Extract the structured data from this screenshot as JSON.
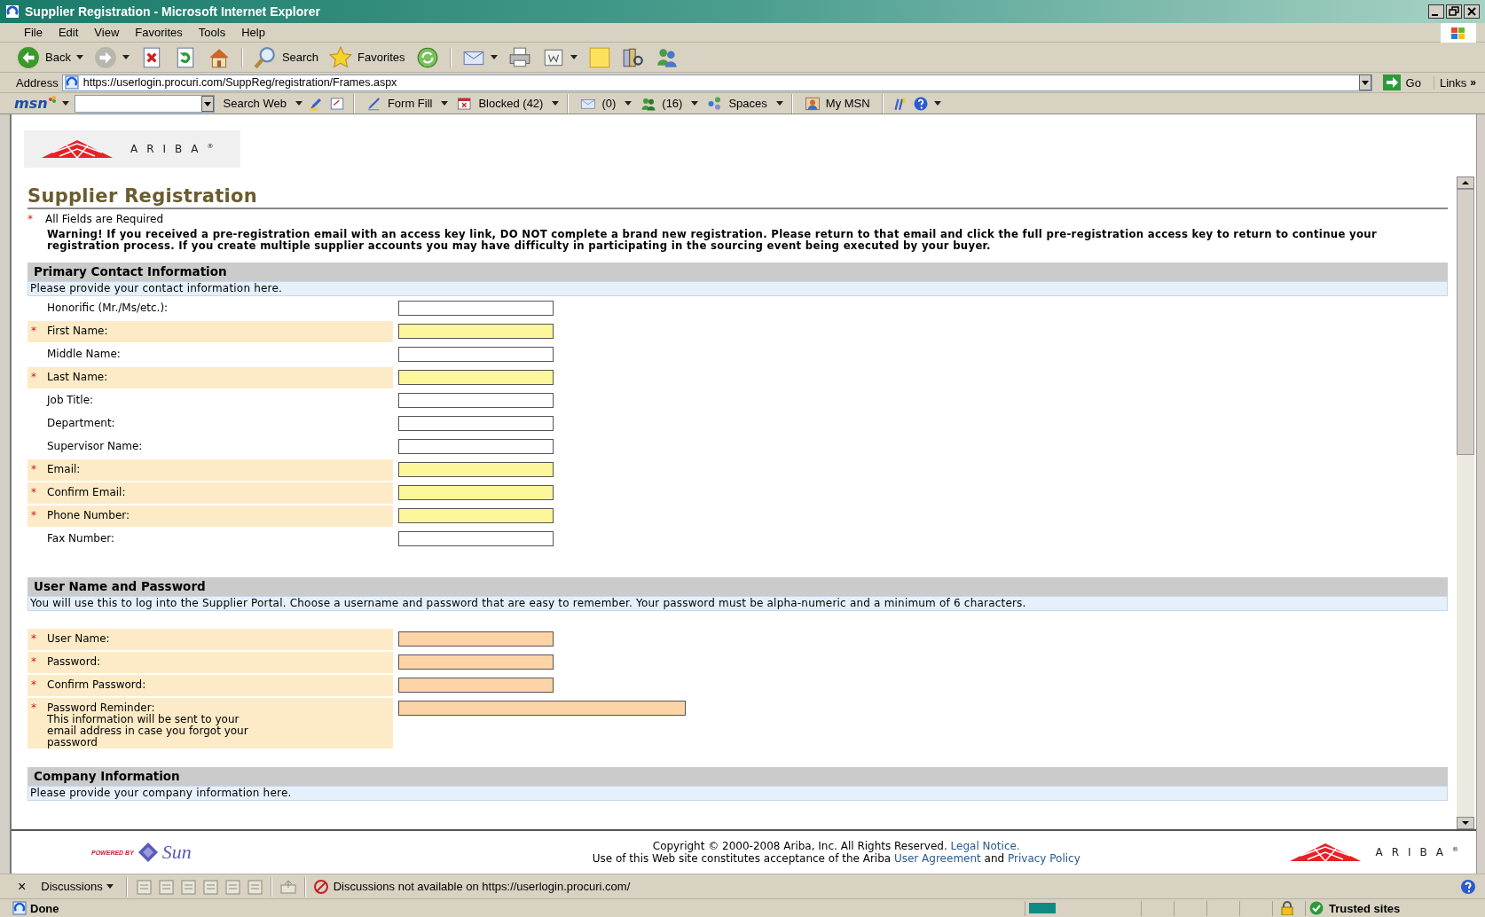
{
  "window": {
    "title": "Supplier Registration - Microsoft Internet Explorer"
  },
  "menu": [
    {
      "label": "File"
    },
    {
      "label": "Edit"
    },
    {
      "label": "View"
    },
    {
      "label": "Favorites"
    },
    {
      "label": "Tools"
    },
    {
      "label": "Help"
    }
  ],
  "toolbar": [
    {
      "kind": "back",
      "label": "Back",
      "dropdown": true
    },
    {
      "kind": "forward",
      "dropdown": true
    },
    {
      "kind": "stop"
    },
    {
      "kind": "refresh"
    },
    {
      "kind": "home"
    },
    {
      "kind": "sep"
    },
    {
      "kind": "search",
      "label": "Search"
    },
    {
      "kind": "favorites",
      "label": "Favorites"
    },
    {
      "kind": "media"
    },
    {
      "kind": "sep"
    },
    {
      "kind": "mail",
      "dropdown": true
    },
    {
      "kind": "print"
    },
    {
      "kind": "edit",
      "dropdown": true
    },
    {
      "kind": "note"
    },
    {
      "kind": "research"
    },
    {
      "kind": "messenger"
    }
  ],
  "address": {
    "label": "Address",
    "value": "https://userlogin.procuri.com/SuppReg/registration/Frames.aspx",
    "go": "Go",
    "links": "Links",
    "chevron": "»"
  },
  "msn_toolbar": [
    {
      "kind": "logo",
      "label": "msn",
      "dropdown": true
    },
    {
      "kind": "searchbox"
    },
    {
      "kind": "text",
      "label": "Search Web",
      "dropdown": true
    },
    {
      "kind": "highlight"
    },
    {
      "kind": "compose"
    },
    {
      "kind": "sep"
    },
    {
      "kind": "formfill",
      "label": "Form Fill",
      "dropdown": true
    },
    {
      "kind": "blocked",
      "label": "Blocked (42)",
      "dropdown": true
    },
    {
      "kind": "sep"
    },
    {
      "kind": "mail",
      "label": "(0)",
      "dropdown": true
    },
    {
      "kind": "buddies",
      "label": "(16)",
      "dropdown": true
    },
    {
      "kind": "spaces",
      "label": "Spaces",
      "dropdown": true
    },
    {
      "kind": "sep"
    },
    {
      "kind": "mymsn",
      "label": "My MSN"
    },
    {
      "kind": "sep"
    },
    {
      "kind": "tools"
    },
    {
      "kind": "help",
      "dropdown": true
    }
  ],
  "logo": {
    "text": "ARIBA$^{®}$"
  },
  "heading": "Supplier Registration",
  "required_note": {
    "mark": "*",
    "text": "All Fields are Required"
  },
  "warning": "Warning! If you received a pre-registration email with an access key link, DO NOT complete a brand new registration. Please return to that email and click the full pre-registration access key to return to continue your registration process. If you create multiple supplier accounts you may have difficulty in participating in the sourcing event being executed by your buyer.",
  "sections": [
    {
      "kind": "contact",
      "title": "Primary Contact Information",
      "description": "Please provide your contact information here.",
      "fields": [
        {
          "label": "Honorific (Mr./Ms/etc.):",
          "required": false,
          "kind": "short"
        },
        {
          "label": "First Name:",
          "required": true,
          "kind": "short"
        },
        {
          "label": "Middle Name:",
          "required": false,
          "kind": "short"
        },
        {
          "label": "Last Name:",
          "required": true,
          "kind": "short"
        },
        {
          "label": "Job Title:",
          "required": false,
          "kind": "short"
        },
        {
          "label": "Department:",
          "required": false,
          "kind": "short"
        },
        {
          "label": "Supervisor Name:",
          "required": false,
          "kind": "short"
        },
        {
          "label": "Email:",
          "required": true,
          "kind": "short"
        },
        {
          "label": "Confirm Email:",
          "required": true,
          "kind": "short"
        },
        {
          "label": "Phone Number:",
          "required": true,
          "kind": "short"
        },
        {
          "label": "Fax Number:",
          "required": false,
          "kind": "short"
        }
      ]
    },
    {
      "kind": "credentials",
      "title": "User Name and Password",
      "description": "You will use this to log into the Supplier Portal. Choose a username and password that are easy to remember. Your password must be alpha-numeric and a minimum of 6 characters.",
      "fields": [
        {
          "label": "User Name:",
          "required": true,
          "kind": "short"
        },
        {
          "label": "Password:",
          "required": true,
          "kind": "short"
        },
        {
          "label": "Confirm Password:",
          "required": true,
          "kind": "short"
        },
        {
          "label": "Password Reminder:",
          "note": "This information will be sent to your email address in case you forgot your password",
          "required": true,
          "kind": "long"
        }
      ]
    },
    {
      "kind": "company",
      "title": "Company Information",
      "description": "Please provide your company information here."
    }
  ],
  "footer": {
    "powered": "POWERED BY",
    "sun": "Sun",
    "lines": [
      [
        {
          "kind": "text",
          "text": "Copyright © 2000-2008 Ariba, Inc. All Rights Reserved. "
        },
        {
          "kind": "link",
          "text": "Legal Notice."
        }
      ],
      [
        {
          "kind": "text",
          "text": "Use of this Web site constitutes acceptance of the Ariba "
        },
        {
          "kind": "link",
          "text": "User Agreement"
        },
        {
          "kind": "text",
          "text": " and "
        },
        {
          "kind": "link",
          "text": "Privacy Policy"
        }
      ]
    ],
    "logo": "ARIBA$^{®}$"
  },
  "discussions": {
    "close": "×",
    "label": "Discussions",
    "message": "Discussions not available on https://userlogin.procuri.com/"
  },
  "status_bar": {
    "text": "Done",
    "zone": "Trusted sites"
  }
}
